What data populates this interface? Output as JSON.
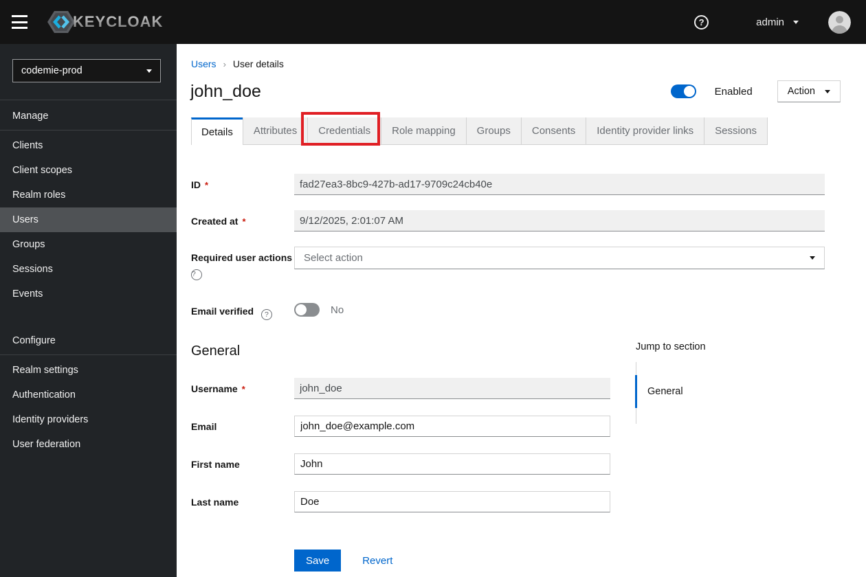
{
  "colors": {
    "accent": "#0066cc",
    "annotation_red": "#e01f24",
    "topbar_bg": "#141414",
    "sidebar_bg": "#212427"
  },
  "topbar": {
    "brand": "KEYCLOAK",
    "user": "admin"
  },
  "sidebar": {
    "realm": "codemie-prod",
    "manage": {
      "title": "Manage",
      "items": [
        "Clients",
        "Client scopes",
        "Realm roles",
        "Users",
        "Groups",
        "Sessions",
        "Events"
      ]
    },
    "configure": {
      "title": "Configure",
      "items": [
        "Realm settings",
        "Authentication",
        "Identity providers",
        "User federation"
      ]
    },
    "active_item": "Users"
  },
  "breadcrumb": {
    "items": [
      "Users",
      "User details"
    ]
  },
  "page": {
    "title": "john_doe",
    "enabled_label": "Enabled",
    "action_label": "Action"
  },
  "tabs": {
    "labels": [
      "Details",
      "Attributes",
      "Credentials",
      "Role mapping",
      "Groups",
      "Consents",
      "Identity provider links",
      "Sessions"
    ],
    "active": "Details",
    "annotated": "Credentials"
  },
  "form": {
    "id_label": "ID",
    "id_value": "fad27ea3-8bc9-427b-ad17-9709c24cb40e",
    "created_label": "Created at",
    "created_value": "9/12/2025, 2:01:07 AM",
    "required_actions_label": "Required user actions",
    "required_actions_placeholder": "Select action",
    "email_verified_label": "Email verified",
    "email_verified_state": "No",
    "general_heading": "General",
    "username_label": "Username",
    "username_value": "john_doe",
    "email_label": "Email",
    "email_value": "john_doe@example.com",
    "first_name_label": "First name",
    "first_name_value": "John",
    "last_name_label": "Last name",
    "last_name_value": "Doe",
    "save_label": "Save",
    "revert_label": "Revert"
  },
  "jump": {
    "heading": "Jump to section",
    "items": [
      "General"
    ]
  }
}
